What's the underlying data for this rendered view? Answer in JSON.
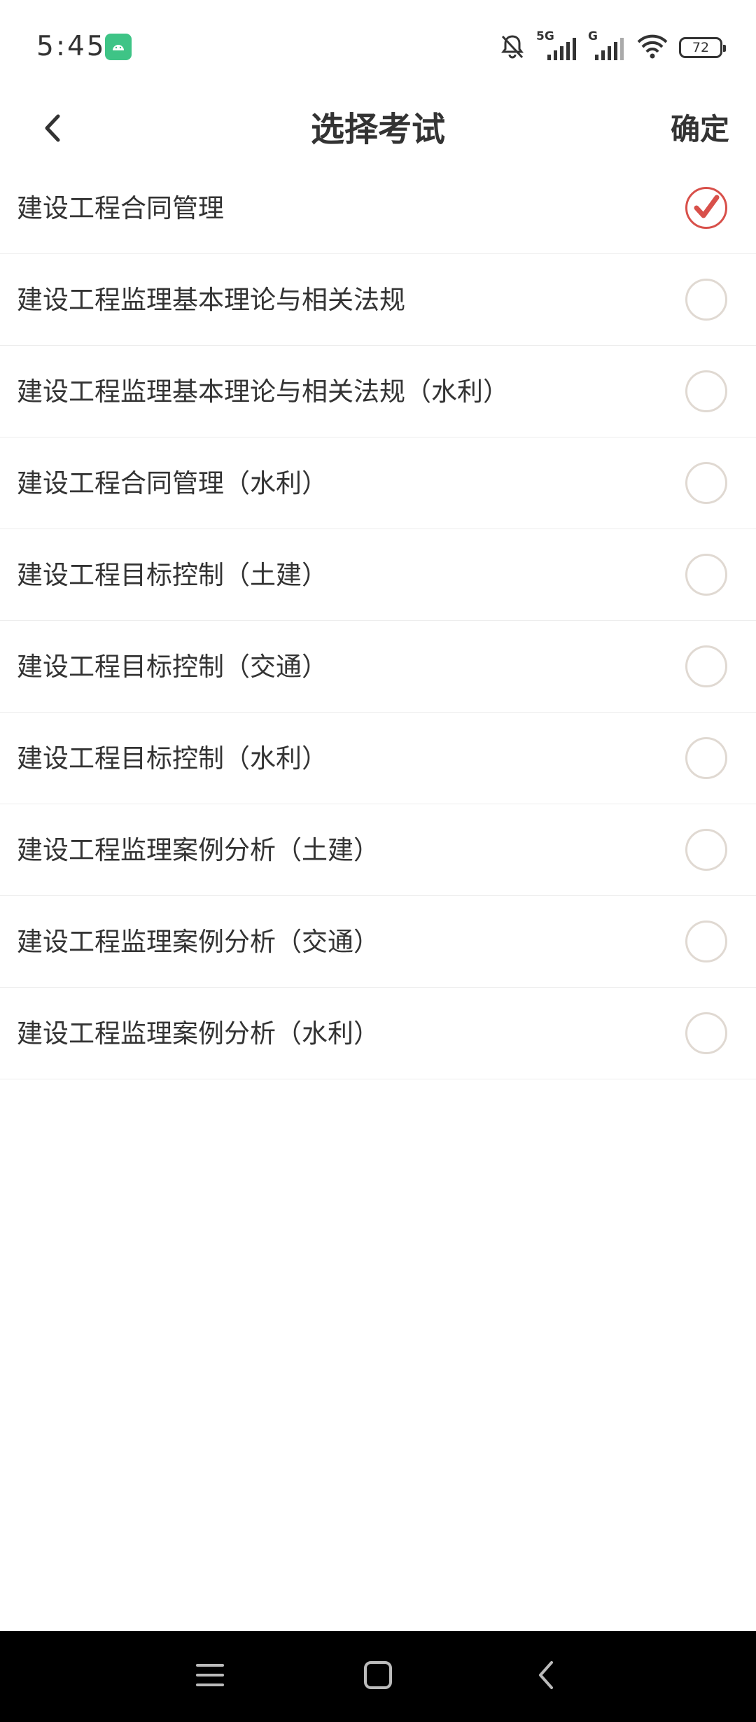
{
  "status_bar": {
    "time": "5:45",
    "network_5g": "5G",
    "network_g": "G",
    "battery_level": "72",
    "icons": [
      "android-app-icon",
      "bell-muted-icon",
      "signal-5g-icon",
      "signal-g-icon",
      "wifi-icon",
      "battery-icon"
    ]
  },
  "header": {
    "title": "选择考试",
    "confirm_label": "确定",
    "back_icon": "chevron-left-icon"
  },
  "exams": [
    {
      "label": "建设工程合同管理",
      "selected": true
    },
    {
      "label": "建设工程监理基本理论与相关法规",
      "selected": false
    },
    {
      "label": "建设工程监理基本理论与相关法规（水利）",
      "selected": false
    },
    {
      "label": "建设工程合同管理（水利）",
      "selected": false
    },
    {
      "label": "建设工程目标控制（土建）",
      "selected": false
    },
    {
      "label": "建设工程目标控制（交通）",
      "selected": false
    },
    {
      "label": "建设工程目标控制（水利）",
      "selected": false
    },
    {
      "label": "建设工程监理案例分析（土建）",
      "selected": false
    },
    {
      "label": "建设工程监理案例分析（交通）",
      "selected": false
    },
    {
      "label": "建设工程监理案例分析（水利）",
      "selected": false
    }
  ],
  "colors": {
    "accent": "#d8504a",
    "radio_border": "#e0d9d2",
    "divider": "#ededed",
    "text": "#333333",
    "nav_bar": "#000000"
  },
  "nav_bar": {
    "icons": [
      "menu-icon",
      "home-icon",
      "back-icon"
    ]
  }
}
